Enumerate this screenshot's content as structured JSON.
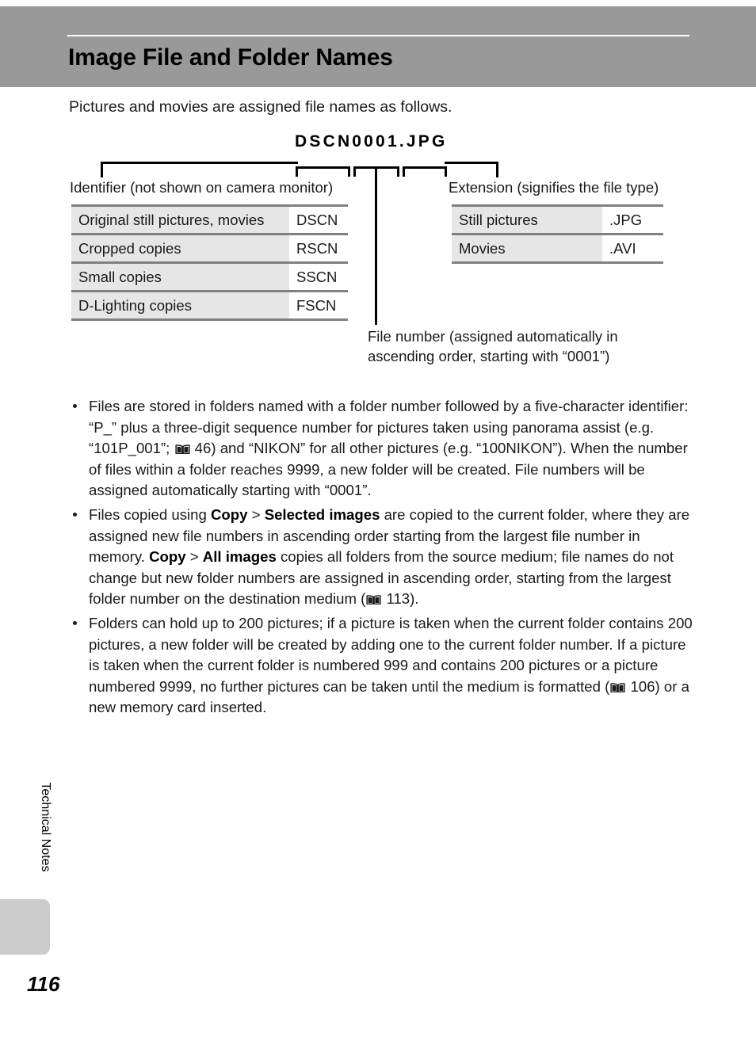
{
  "header": {
    "title": "Image File and Folder Names"
  },
  "intro": "Pictures and movies are assigned file names as follows.",
  "diagram": {
    "filename": "DSCN0001.JPG",
    "identifier_caption": "Identifier (not shown on camera monitor)",
    "extension_caption": "Extension (signifies the file type)",
    "file_number_note": "File number (assigned automatically in ascending order, starting with “0001”)",
    "identifier_table": {
      "rows": [
        {
          "label": "Original still pictures, movies",
          "value": "DSCN"
        },
        {
          "label": "Cropped copies",
          "value": "RSCN"
        },
        {
          "label": "Small copies",
          "value": "SSCN"
        },
        {
          "label": "D-Lighting copies",
          "value": "FSCN"
        }
      ]
    },
    "extension_table": {
      "rows": [
        {
          "label": "Still pictures",
          "value": ".JPG"
        },
        {
          "label": "Movies",
          "value": ".AVI"
        }
      ]
    }
  },
  "bullets": [
    {
      "id": "bullet-folders-naming",
      "segments": [
        {
          "t": "text",
          "v": "Files are stored in folders named with a folder number followed by a five-character identifier: “P_” plus a three-digit sequence number for pictures taken using panorama assist (e.g. “101P_001”; "
        },
        {
          "t": "icon",
          "v": "book-icon"
        },
        {
          "t": "text",
          "v": " 46) and “NIKON” for all other pictures (e.g. “100NIKON”). When the number of files within a folder reaches 9999, a new folder will be created. File numbers will be assigned automatically starting with “0001”."
        }
      ]
    },
    {
      "id": "bullet-copy-behavior",
      "segments": [
        {
          "t": "text",
          "v": "Files copied using "
        },
        {
          "t": "bold",
          "v": "Copy"
        },
        {
          "t": "text",
          "v": " > "
        },
        {
          "t": "bold",
          "v": "Selected images"
        },
        {
          "t": "text",
          "v": " are copied to the current folder, where they are assigned new file numbers in ascending order starting from the largest file number in memory. "
        },
        {
          "t": "bold",
          "v": "Copy"
        },
        {
          "t": "text",
          "v": " > "
        },
        {
          "t": "bold",
          "v": "All images"
        },
        {
          "t": "text",
          "v": " copies all folders from the source medium; file names do not change but new folder numbers are assigned in ascending order, starting from the largest folder number on the destination medium ("
        },
        {
          "t": "icon",
          "v": "book-icon"
        },
        {
          "t": "text",
          "v": " 113)."
        }
      ]
    },
    {
      "id": "bullet-folder-capacity",
      "segments": [
        {
          "t": "text",
          "v": "Folders can hold up to 200 pictures; if a picture is taken when the current folder contains 200 pictures, a new folder will be created by adding one to the current folder number. If a picture is taken when the current folder is numbered 999 and contains 200 pictures or a picture numbered 9999, no further pictures can be taken until the medium is formatted ("
        },
        {
          "t": "icon",
          "v": "book-icon"
        },
        {
          "t": "text",
          "v": " 106) or a new memory card inserted."
        }
      ]
    }
  ],
  "sidebar": {
    "section_label": "Technical Notes"
  },
  "footer": {
    "page_number": "116"
  },
  "colors": {
    "header_band": "#999999",
    "table_label_fill": "#e6e6e6",
    "table_rule": "#808080",
    "side_tab": "#cccccc"
  }
}
